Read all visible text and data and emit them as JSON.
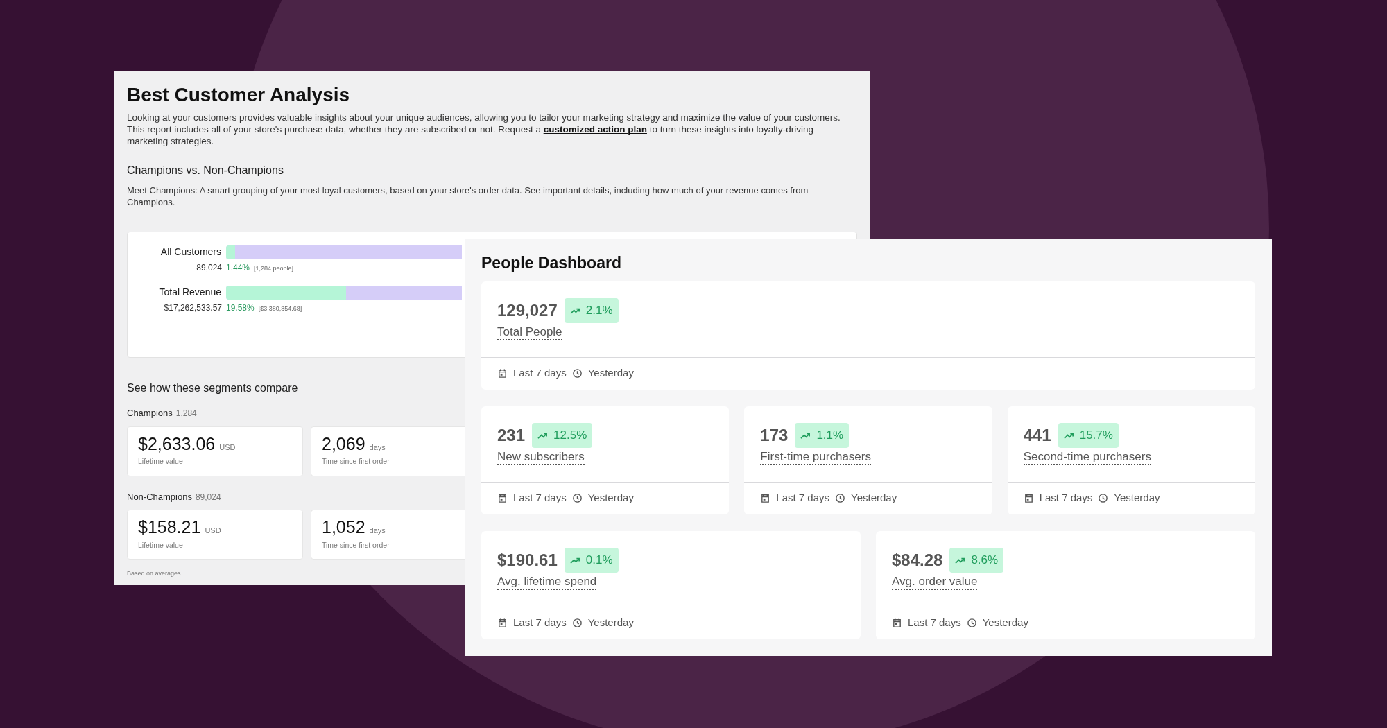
{
  "analysis": {
    "title": "Best Customer Analysis",
    "intro": {
      "before": "Looking at your customers provides valuable insights about your unique audiences, allowing you to tailor your marketing strategy and maximize the value of your customers. This report includes all of your store's purchase data, whether they are subscribed or not. Request a ",
      "link": "customized action plan",
      "after": " to turn these insights into loyalty-driving marketing strategies."
    },
    "section_title": "Champions vs. Non-Champions",
    "section_text": "Meet Champions: A smart grouping of your most loyal customers, based on your store's order data. See important details, including how much of your revenue comes from Champions.",
    "bars": [
      {
        "label": "All Customers",
        "total": "89,024",
        "percent": "1.44%",
        "detail": "[1,284 people]",
        "level": 0.0144
      },
      {
        "label": "Total Revenue",
        "total": "$17,262,533.57",
        "percent": "19.58%",
        "detail": "[$3,380,854.68]",
        "level": 0.1958
      }
    ],
    "compare_title": "See how these segments compare",
    "segments": [
      {
        "name": "Champions",
        "count": "1,284",
        "stats": [
          {
            "value": "$2,633.06",
            "unit": "USD",
            "label": "Lifetime value"
          },
          {
            "value": "2,069",
            "unit": "days",
            "label": "Time since first order"
          }
        ]
      },
      {
        "name": "Non-Champions",
        "count": "89,024",
        "stats": [
          {
            "value": "$158.21",
            "unit": "USD",
            "label": "Lifetime value"
          },
          {
            "value": "1,052",
            "unit": "days",
            "label": "Time since first order"
          }
        ]
      }
    ],
    "footnote": "Based on averages"
  },
  "dashboard": {
    "title": "People Dashboard",
    "rows": [
      [
        {
          "value": "129,027",
          "change": "2.1%",
          "label": "Total People",
          "period": "Last 7 days",
          "updated": "Yesterday"
        }
      ],
      [
        {
          "value": "231",
          "change": "12.5%",
          "label": "New subscribers",
          "period": "Last 7 days",
          "updated": "Yesterday"
        },
        {
          "value": "173",
          "change": "1.1%",
          "label": "First-time purchasers",
          "period": "Last 7 days",
          "updated": "Yesterday"
        },
        {
          "value": "441",
          "change": "15.7%",
          "label": "Second-time purchasers",
          "period": "Last 7 days",
          "updated": "Yesterday"
        }
      ],
      [
        {
          "value": "$190.61",
          "change": "0.1%",
          "label": "Avg. lifetime spend",
          "period": "Last 7 days",
          "updated": "Yesterday"
        },
        {
          "value": "$84.28",
          "change": "8.6%",
          "label": "Avg. order value",
          "period": "Last 7 days",
          "updated": "Yesterday"
        }
      ]
    ]
  }
}
